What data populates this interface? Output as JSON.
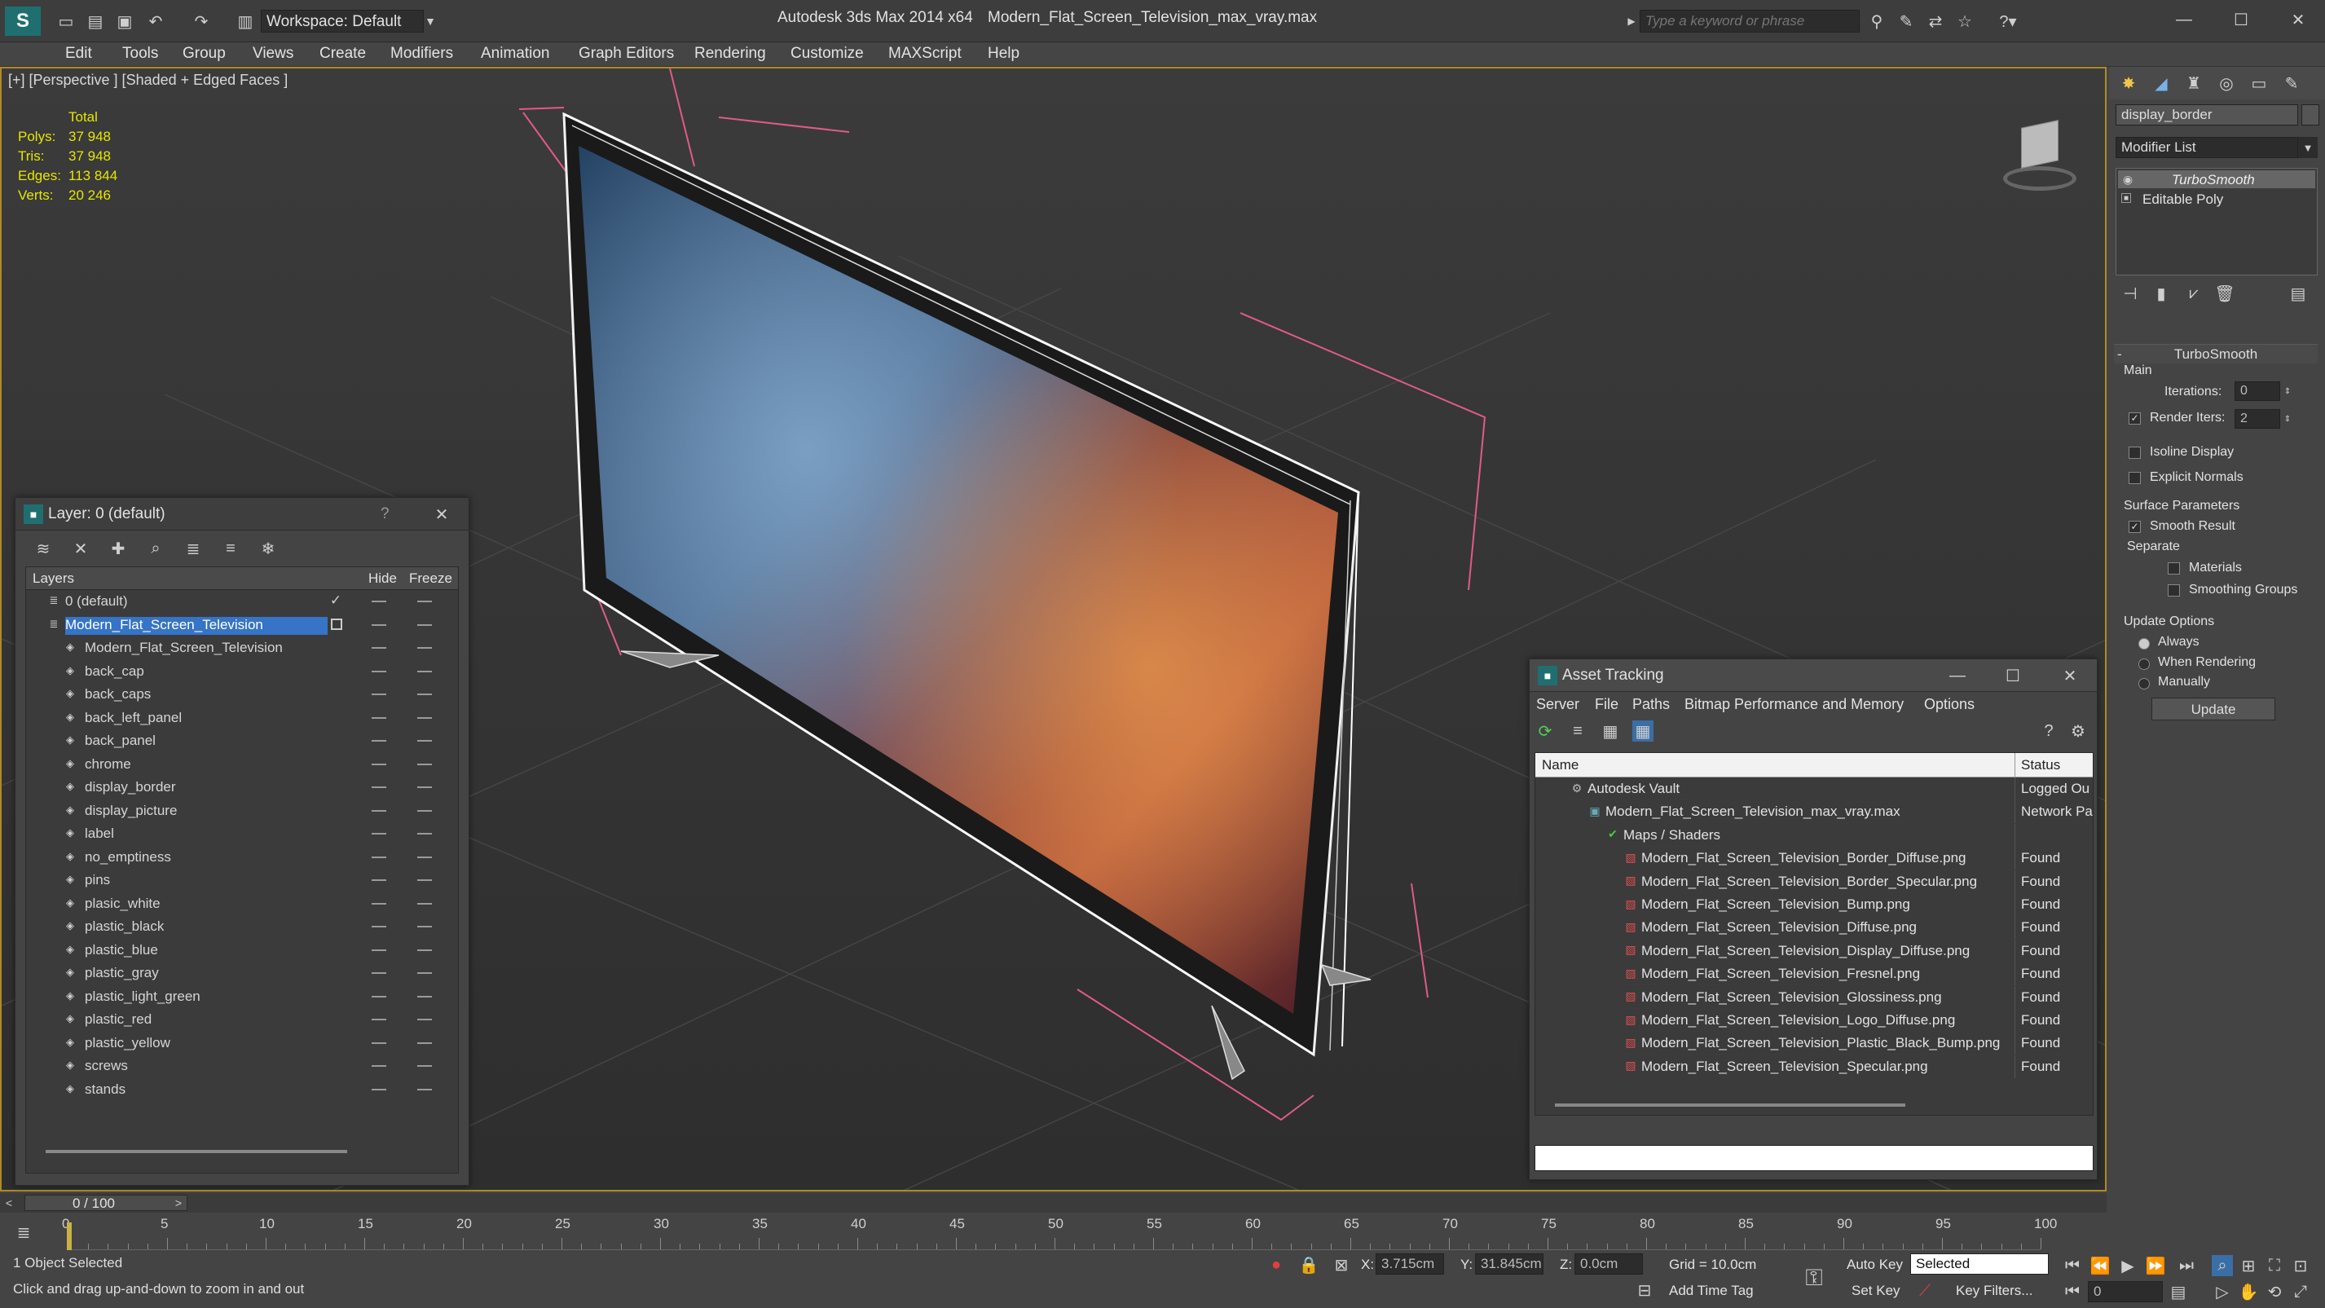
{
  "title": {
    "workspace": "Workspace: Default",
    "app": "Autodesk 3ds Max  2014 x64",
    "file": "Modern_Flat_Screen_Television_max_vray.max",
    "search_placeholder": "Type a keyword or phrase"
  },
  "menu": [
    "Edit",
    "Tools",
    "Group",
    "Views",
    "Create",
    "Modifiers",
    "Animation",
    "Graph Editors",
    "Rendering",
    "Customize",
    "MAXScript",
    "Help"
  ],
  "viewport": {
    "label": "[+] [Perspective ] [Shaded + Edged Faces ]",
    "stats": {
      "header": "Total",
      "rows": [
        {
          "k": "Polys:",
          "v": "37 948"
        },
        {
          "k": "Tris:",
          "v": "37 948"
        },
        {
          "k": "Edges:",
          "v": "113 844"
        },
        {
          "k": "Verts:",
          "v": "20 246"
        }
      ]
    }
  },
  "layers_panel": {
    "title": "Layer: 0 (default)",
    "help": "?",
    "columns": {
      "name": "Layers",
      "hide": "Hide",
      "freeze": "Freeze"
    },
    "rows": [
      {
        "name": "0 (default)",
        "level": 0
      },
      {
        "name": "Modern_Flat_Screen_Television",
        "level": 0
      },
      {
        "name": "Modern_Flat_Screen_Television",
        "level": 1
      },
      {
        "name": "back_cap",
        "level": 1
      },
      {
        "name": "back_caps",
        "level": 1
      },
      {
        "name": "back_left_panel",
        "level": 1
      },
      {
        "name": "back_panel",
        "level": 1
      },
      {
        "name": "chrome",
        "level": 1
      },
      {
        "name": "display_border",
        "level": 1
      },
      {
        "name": "display_picture",
        "level": 1
      },
      {
        "name": "label",
        "level": 1
      },
      {
        "name": "no_emptiness",
        "level": 1
      },
      {
        "name": "pins",
        "level": 1
      },
      {
        "name": "plasic_white",
        "level": 1
      },
      {
        "name": "plastic_black",
        "level": 1
      },
      {
        "name": "plastic_blue",
        "level": 1
      },
      {
        "name": "plastic_gray",
        "level": 1
      },
      {
        "name": "plastic_light_green",
        "level": 1
      },
      {
        "name": "plastic_red",
        "level": 1
      },
      {
        "name": "plastic_yellow",
        "level": 1
      },
      {
        "name": "screws",
        "level": 1
      },
      {
        "name": "stands",
        "level": 1
      }
    ]
  },
  "asset_tracking": {
    "title": "Asset Tracking",
    "menu": [
      "Server",
      "File",
      "Paths",
      "Bitmap Performance and Memory",
      "Options"
    ],
    "columns": {
      "name": "Name",
      "status": "Status"
    },
    "rows": [
      {
        "name": "Autodesk Vault",
        "status": "Logged Ou",
        "level": 0
      },
      {
        "name": "Modern_Flat_Screen_Television_max_vray.max",
        "status": "Network Pa",
        "level": 1
      },
      {
        "name": "Maps / Shaders",
        "status": "",
        "level": 2
      },
      {
        "name": "Modern_Flat_Screen_Television_Border_Diffuse.png",
        "status": "Found",
        "level": 3
      },
      {
        "name": "Modern_Flat_Screen_Television_Border_Specular.png",
        "status": "Found",
        "level": 3
      },
      {
        "name": "Modern_Flat_Screen_Television_Bump.png",
        "status": "Found",
        "level": 3
      },
      {
        "name": "Modern_Flat_Screen_Television_Diffuse.png",
        "status": "Found",
        "level": 3
      },
      {
        "name": "Modern_Flat_Screen_Television_Display_Diffuse.png",
        "status": "Found",
        "level": 3
      },
      {
        "name": "Modern_Flat_Screen_Television_Fresnel.png",
        "status": "Found",
        "level": 3
      },
      {
        "name": "Modern_Flat_Screen_Television_Glossiness.png",
        "status": "Found",
        "level": 3
      },
      {
        "name": "Modern_Flat_Screen_Television_Logo_Diffuse.png",
        "status": "Found",
        "level": 3
      },
      {
        "name": "Modern_Flat_Screen_Television_Plastic_Black_Bump.png",
        "status": "Found",
        "level": 3
      },
      {
        "name": "Modern_Flat_Screen_Television_Specular.png",
        "status": "Found",
        "level": 3
      }
    ]
  },
  "command_panel": {
    "object_name": "display_border",
    "modifier_list": "Modifier List",
    "stack": [
      "TurboSmooth",
      "Editable Poly"
    ],
    "rollout": "TurboSmooth",
    "main_label": "Main",
    "iterations_label": "Iterations:",
    "iterations": "0",
    "render_iters_label": "Render Iters:",
    "render_iters": "2",
    "isoline": "Isoline Display",
    "explicit": "Explicit Normals",
    "surface_label": "Surface Parameters",
    "smooth_result": "Smooth Result",
    "separate_label": "Separate",
    "materials": "Materials",
    "smoothing_groups": "Smoothing Groups",
    "update_label": "Update Options",
    "always": "Always",
    "when_rendering": "When Rendering",
    "manually": "Manually",
    "update_button": "Update"
  },
  "timeline": {
    "frame": "0 / 100",
    "ticks": [
      "0",
      "5",
      "10",
      "15",
      "20",
      "25",
      "30",
      "35",
      "40",
      "45",
      "50",
      "55",
      "60",
      "65",
      "70",
      "75",
      "80",
      "85",
      "90",
      "95",
      "100"
    ]
  },
  "status": {
    "selected": "1 Object Selected",
    "prompt": "Click and drag up-and-down to zoom in and out",
    "x_label": "X:",
    "x": "3.715cm",
    "y_label": "Y:",
    "y": "31.845cm",
    "z_label": "Z:",
    "z": "0.0cm",
    "grid": "Grid = 10.0cm",
    "auto_key": "Auto Key",
    "set_key": "Set Key",
    "selected_dropdown": "Selected",
    "key_filters": "Key Filters...",
    "add_time_tag": "Add Time Tag",
    "frame_field": "0"
  }
}
